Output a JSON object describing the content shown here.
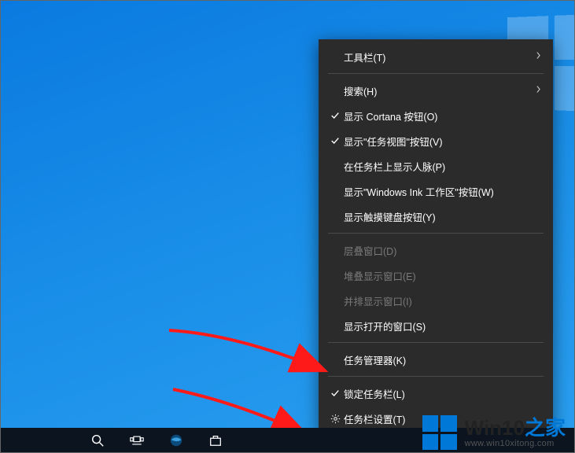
{
  "menu": {
    "toolbars": "工具栏(T)",
    "search": "搜索(H)",
    "show_cortana": "显示 Cortana 按钮(O)",
    "show_taskview": "显示\"任务视图\"按钮(V)",
    "show_people": "在任务栏上显示人脉(P)",
    "show_ink": "显示\"Windows Ink 工作区\"按钮(W)",
    "show_touch_kb": "显示触摸键盘按钮(Y)",
    "cascade": "层叠窗口(D)",
    "stacked": "堆叠显示窗口(E)",
    "sidebyside": "并排显示窗口(I)",
    "show_open": "显示打开的窗口(S)",
    "task_manager": "任务管理器(K)",
    "lock_taskbar": "锁定任务栏(L)",
    "taskbar_settings": "任务栏设置(T)"
  },
  "watermark": {
    "brand_a": "Win10",
    "brand_b": "之家",
    "url": "www.win10xitong.com"
  },
  "icons": {
    "check": "checkmark-icon",
    "gear": "gear-icon",
    "chevron": "chevron-right-icon",
    "search": "search-icon",
    "taskview": "taskview-icon",
    "store": "store-icon"
  }
}
